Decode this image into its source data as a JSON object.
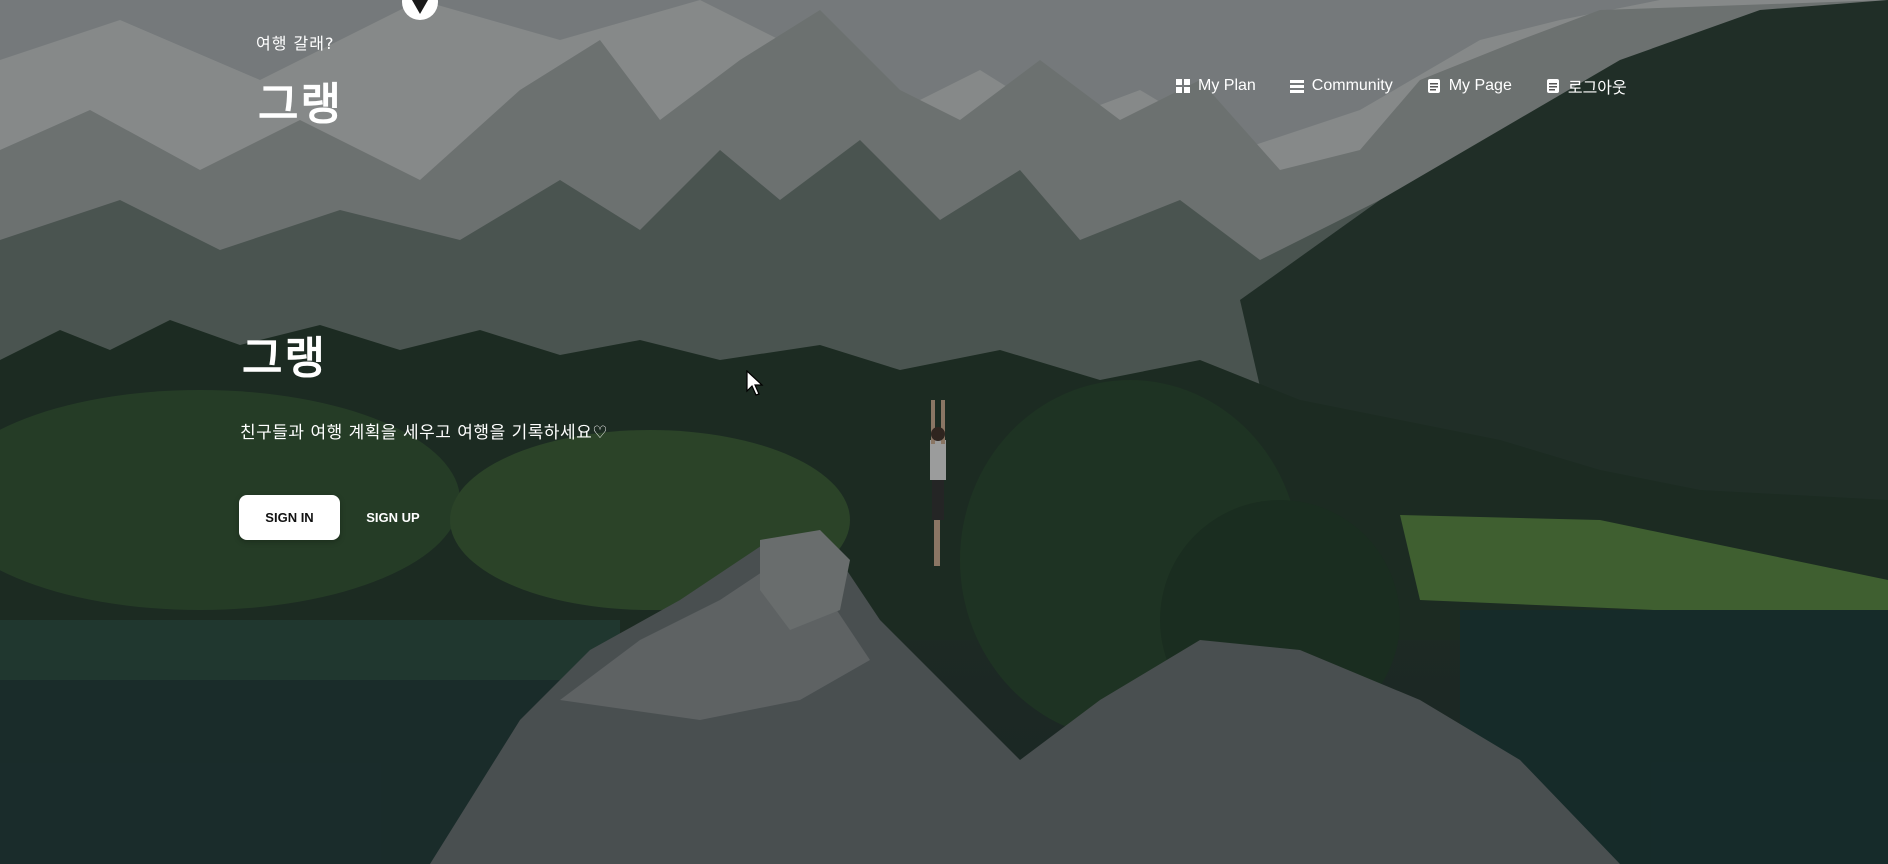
{
  "brand": {
    "subtitle": "여행 갈래?",
    "name": "그랭"
  },
  "nav": {
    "items": [
      {
        "label": "My Plan",
        "icon": "grid-icon"
      },
      {
        "label": "Community",
        "icon": "list-icon"
      },
      {
        "label": "My Page",
        "icon": "document-icon"
      },
      {
        "label": "로그아웃",
        "icon": "document-icon"
      }
    ]
  },
  "hero": {
    "title": "그랭",
    "subtitle": "친구들과 여행 계획을 세우고 여행을 기록하세요♡",
    "signin_label": "SIGN IN",
    "signup_label": "SIGN UP"
  },
  "colors": {
    "button_bg": "#ffffff",
    "text": "#ffffff"
  }
}
